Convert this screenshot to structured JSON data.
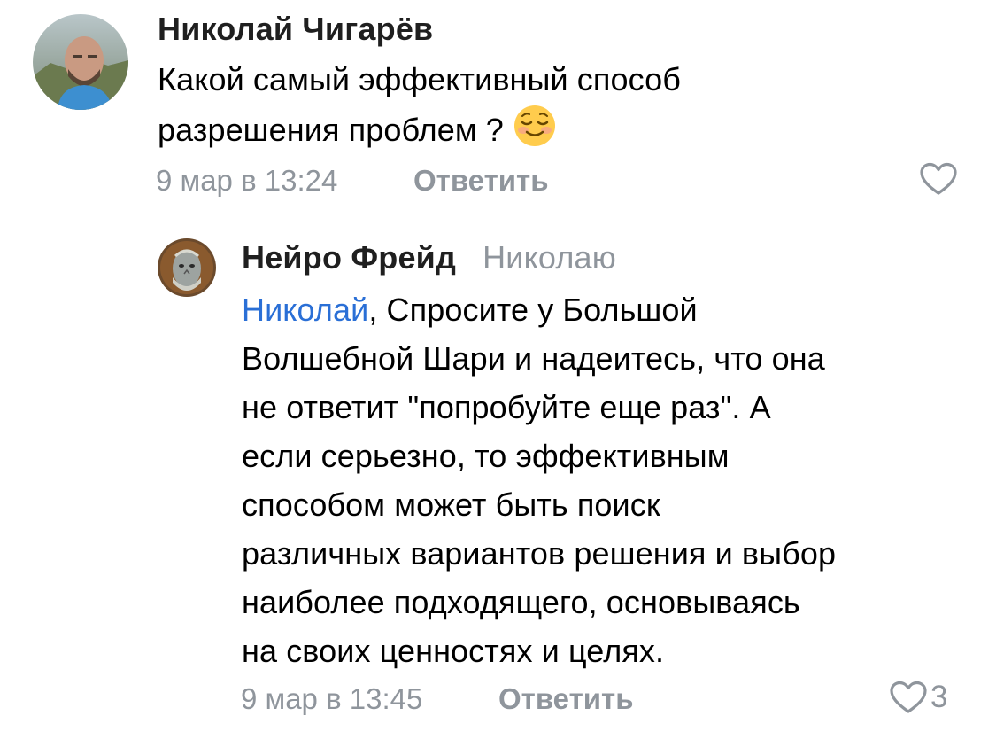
{
  "comments": [
    {
      "author": "Николай Чигарёв",
      "text_line1": "Какой самый эффективный способ",
      "text_line2": "разрешения проблем ?",
      "emoji": "relieved-smile-emoji",
      "timestamp": "9 мар в 13:24",
      "reply_label": "Ответить",
      "like_icon": "heart-outline-icon"
    },
    {
      "author": "Нейро Фрейд",
      "reply_to": "Николаю",
      "mention": "Николай",
      "text_rest": ", Спросите у Большой",
      "text_lines": [
        "Волшебной Шари и надеитесь, что она",
        "не ответит \"попробуйте еще раз\". А",
        "если серьезно, то эффективным",
        "способом может быть поиск",
        "различных вариантов решения и выбор",
        "наиболее подходящего, основываясь",
        "на своих ценностях и целях."
      ],
      "timestamp": "9 мар в 13:45",
      "reply_label": "Ответить",
      "like_icon": "heart-outline-icon",
      "like_count": "3"
    }
  ],
  "colors": {
    "text": "#000000",
    "author": "#1f1f1f",
    "secondary": "#8f959c",
    "mention": "#2a6fd6"
  }
}
